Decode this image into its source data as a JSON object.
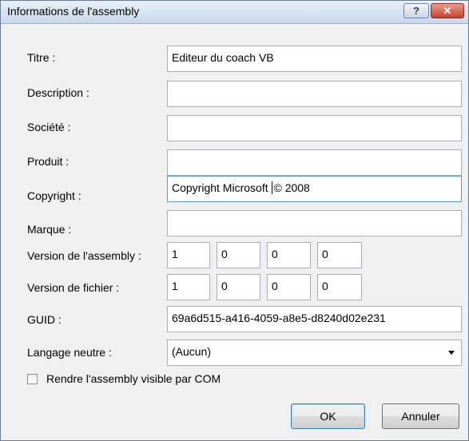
{
  "window": {
    "title": "Informations de l'assembly",
    "help_glyph": "?",
    "close_glyph": "✕"
  },
  "form": {
    "titre": {
      "label": "Titre :",
      "value": "Editeur du coach VB"
    },
    "description": {
      "label": "Description :",
      "value": ""
    },
    "societe": {
      "label": "Société :",
      "value": ""
    },
    "produit": {
      "label": "Produit :",
      "value": ""
    },
    "copyright": {
      "label": "Copyright :",
      "value_before_caret": "Copyright Microsoft ",
      "value_after_caret": "© 2008"
    },
    "marque": {
      "label": "Marque :",
      "value": ""
    },
    "assembly_version": {
      "label": "Version de l'assembly :",
      "parts": [
        "1",
        "0",
        "0",
        "0"
      ]
    },
    "file_version": {
      "label": "Version de fichier :",
      "parts": [
        "1",
        "0",
        "0",
        "0"
      ]
    },
    "guid": {
      "label": "GUID :",
      "value": "69a6d515-a416-4059-a8e5-d8240d02e231"
    },
    "neutral_language": {
      "label": "Langage neutre :",
      "selected": "(Aucun)"
    },
    "com_visible": {
      "label": "Rendre l'assembly visible par COM",
      "checked": false
    }
  },
  "buttons": {
    "ok": "OK",
    "cancel": "Annuler"
  },
  "icons": {
    "help": "help-icon",
    "close": "close-icon",
    "dropdown": "chevron-down-icon"
  }
}
